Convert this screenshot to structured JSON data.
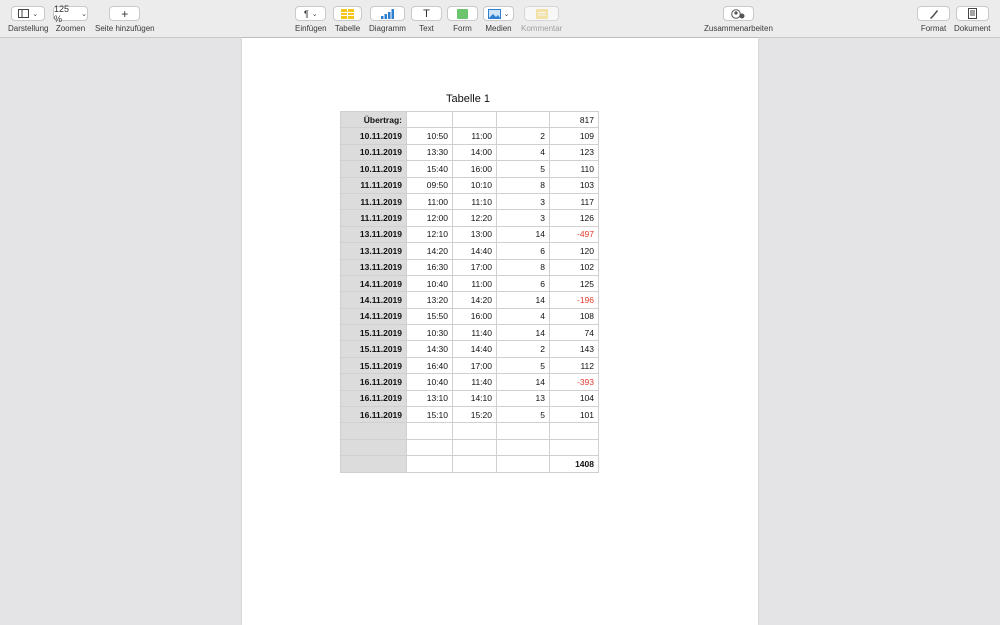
{
  "toolbar": {
    "view": {
      "label": "Darstellung"
    },
    "zoom": {
      "value": "125 %",
      "label": "Zoomen"
    },
    "add_page": {
      "label": "Seite hinzufügen"
    },
    "insert": {
      "label": "Einfügen"
    },
    "table": {
      "label": "Tabelle"
    },
    "chart": {
      "label": "Diagramm"
    },
    "text": {
      "label": "Text"
    },
    "shape": {
      "label": "Form"
    },
    "media": {
      "label": "Medien"
    },
    "comment": {
      "label": "Kommentar"
    },
    "collaborate": {
      "label": "Zusammenarbeiten"
    },
    "format": {
      "label": "Format"
    },
    "document": {
      "label": "Dokument"
    }
  },
  "colors": {
    "negative": "#e03a2f",
    "header_col": "#dcdcdc",
    "table_icon": "#f5c518",
    "chart_icon": "#2f7fd1",
    "shape_icon": "#6cc46c"
  },
  "table": {
    "title": "Tabelle 1",
    "rows": [
      [
        "Übertrag:",
        "",
        "",
        "",
        "817"
      ],
      [
        "10.11.2019",
        "10:50",
        "11:00",
        "2",
        "109"
      ],
      [
        "10.11.2019",
        "13:30",
        "14:00",
        "4",
        "123"
      ],
      [
        "10.11.2019",
        "15:40",
        "16:00",
        "5",
        "110"
      ],
      [
        "11.11.2019",
        "09:50",
        "10:10",
        "8",
        "103"
      ],
      [
        "11.11.2019",
        "11:00",
        "11:10",
        "3",
        "117"
      ],
      [
        "11.11.2019",
        "12:00",
        "12:20",
        "3",
        "126"
      ],
      [
        "13.11.2019",
        "12:10",
        "13:00",
        "14",
        "-497"
      ],
      [
        "13.11.2019",
        "14:20",
        "14:40",
        "6",
        "120"
      ],
      [
        "13.11.2019",
        "16:30",
        "17:00",
        "8",
        "102"
      ],
      [
        "14.11.2019",
        "10:40",
        "11:00",
        "6",
        "125"
      ],
      [
        "14.11.2019",
        "13:20",
        "14:20",
        "14",
        "-196"
      ],
      [
        "14.11.2019",
        "15:50",
        "16:00",
        "4",
        "108"
      ],
      [
        "15.11.2019",
        "10:30",
        "11:40",
        "14",
        "74"
      ],
      [
        "15.11.2019",
        "14:30",
        "14:40",
        "2",
        "143"
      ],
      [
        "15.11.2019",
        "16:40",
        "17:00",
        "5",
        "112"
      ],
      [
        "16.11.2019",
        "10:40",
        "11:40",
        "14",
        "-393"
      ],
      [
        "16.11.2019",
        "13:10",
        "14:10",
        "13",
        "104"
      ],
      [
        "16.11.2019",
        "15:10",
        "15:20",
        "5",
        "101"
      ],
      [
        "",
        "",
        "",
        "",
        ""
      ],
      [
        "",
        "",
        "",
        "",
        ""
      ],
      [
        "",
        "",
        "",
        "",
        "1408"
      ]
    ]
  }
}
